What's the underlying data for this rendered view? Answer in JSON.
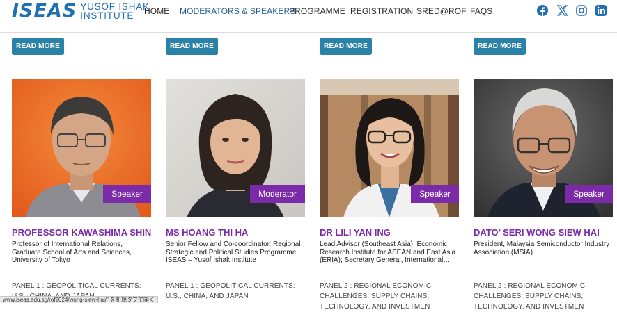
{
  "header": {
    "logo_mark": "ISEAS",
    "logo_line1": "YUSOF ISHAK",
    "logo_line2": "INSTITUTE",
    "nav": [
      "HOME",
      "MODERATORS & SPEAKERS",
      "PROGRAMME",
      "REGISTRATION",
      "SRED@ROF",
      "FAQS"
    ],
    "active_nav": "MODERATORS & SPEAKERS",
    "social": [
      "facebook-icon",
      "x-icon",
      "instagram-icon",
      "linkedin-icon"
    ]
  },
  "read_more_label": "READ MORE",
  "cards": [
    {
      "badge": "Speaker",
      "name": "PROFESSOR KAWASHIMA SHIN",
      "role": "Professor of International Relations, Graduate School of Arts and Sciences, University of Tokyo",
      "panel": "PANEL 1 : GEOPOLITICAL CURRENTS: U.S., CHINA, AND JAPAN"
    },
    {
      "badge": "Moderator",
      "name": "MS HOANG THI HA",
      "role": "Senior Fellow and Co-coordinator, Regional Strategic and Political Studies Programme, ISEAS – Yusof Ishak Institute",
      "panel": "PANEL 1 : GEOPOLITICAL CURRENTS: U.S., CHINA, AND JAPAN"
    },
    {
      "badge": "Speaker",
      "name": "DR LILI YAN ING",
      "role": "Lead Advisor (Southeast Asia), Economic Research Institute for ASEAN and East Asia (ERIA); Secretary General, International…",
      "panel": "PANEL 2 : REGIONAL ECONOMIC CHALLENGES: SUPPLY CHAINS, TECHNOLOGY, AND INVESTMENT"
    },
    {
      "badge": "Speaker",
      "name": "DATO’ SERI WONG SIEW HAI",
      "role": "President, Malaysia Semiconductor Industry Association (MSIA)",
      "panel": "PANEL 2 : REGIONAL ECONOMIC CHALLENGES: SUPPLY CHAINS, TECHNOLOGY, AND INVESTMENT"
    }
  ],
  "status_url": "www.iseas.edu.sg/rof2024/wong-siew-hai/” を新規タブで開く",
  "colors": {
    "brand_blue": "#1f6fb5",
    "button_teal": "#2a82a6",
    "accent_purple": "#7b2aa8"
  }
}
